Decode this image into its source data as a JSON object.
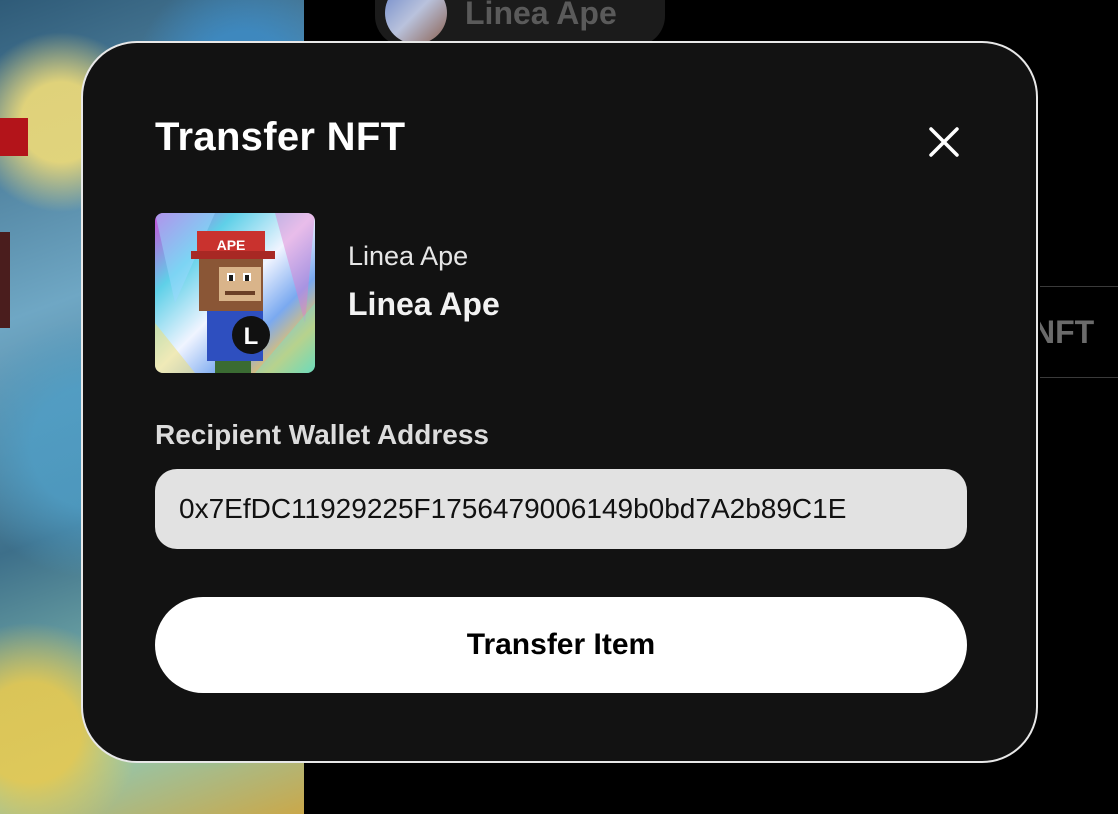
{
  "background": {
    "header_name": "Linea Ape",
    "tab_label_partial": "NFT"
  },
  "modal": {
    "title": "Transfer NFT",
    "close_icon": "close-icon",
    "nft": {
      "collection": "Linea Ape",
      "name": "Linea Ape",
      "cap_text": "APE",
      "badge_letter": "L"
    },
    "recipient": {
      "label": "Recipient Wallet Address",
      "value": "0x7EfDC11929225F1756479006149b0bd7A2b89C1E"
    },
    "submit_label": "Transfer Item"
  },
  "colors": {
    "modal_bg": "#121212",
    "modal_border": "#e8e8e8",
    "input_bg": "#e2e2e2",
    "button_bg": "#ffffff",
    "spellcheck_underline": "#e0473c"
  }
}
